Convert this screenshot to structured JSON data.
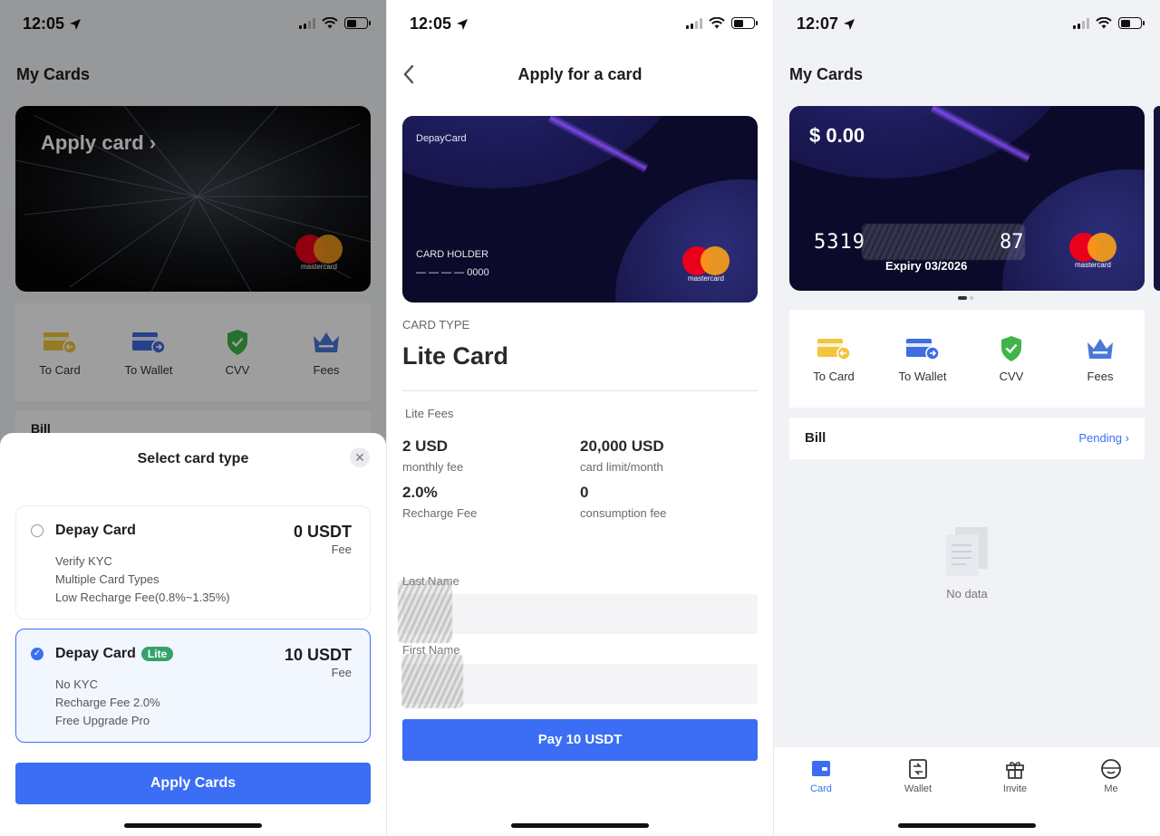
{
  "status": {
    "p1_time": "12:05",
    "p2_time": "12:05",
    "p3_time": "12:07"
  },
  "panel1": {
    "title": "My Cards",
    "card_cta": "Apply card ›",
    "mastercard": "mastercard",
    "actions": [
      {
        "label": "To Card",
        "icon": "card-transfer-icon"
      },
      {
        "label": "To Wallet",
        "icon": "wallet-transfer-icon"
      },
      {
        "label": "CVV",
        "icon": "shield-check-icon"
      },
      {
        "label": "Fees",
        "icon": "crown-icon"
      }
    ],
    "bill_label": "Bill",
    "sheet": {
      "title": "Select card type",
      "close": "✕",
      "options": [
        {
          "name": "Depay Card",
          "badge": "",
          "price": "0 USDT",
          "fee": "Fee",
          "lines": [
            "Verify KYC",
            "Multiple Card Types",
            "Low Recharge Fee(0.8%~1.35%)"
          ],
          "selected": false
        },
        {
          "name": "Depay Card",
          "badge": "Lite",
          "price": "10 USDT",
          "fee": "Fee",
          "lines": [
            "No KYC",
            "Recharge Fee 2.0%",
            "Free Upgrade Pro"
          ],
          "selected": true
        }
      ],
      "apply_button": "Apply Cards"
    }
  },
  "panel2": {
    "title": "Apply for a card",
    "card": {
      "brand": "DepayCard",
      "holder_label": "CARD HOLDER",
      "number": "— — — — 0000",
      "mastercard": "mastercard"
    },
    "card_type_label": "CARD TYPE",
    "card_type_value": "Lite Card",
    "fees_label": "Lite Fees",
    "fees": [
      {
        "value": "2 USD",
        "label": "monthly fee"
      },
      {
        "value": "20,000 USD",
        "label": "card limit/month"
      },
      {
        "value": "2.0%",
        "label": "Recharge Fee"
      },
      {
        "value": "0",
        "label": "consumption fee"
      }
    ],
    "last_name_label": "Last Name",
    "first_name_label": "First Name",
    "last_name_value": "",
    "first_name_value": "",
    "pay_button": "Pay 10 USDT"
  },
  "panel3": {
    "title": "My Cards",
    "card": {
      "balance": "$ 0.00",
      "number_start": "5319",
      "number_end": "87",
      "expiry": "Expiry 03/2026",
      "mastercard": "mastercard"
    },
    "actions": [
      {
        "label": "To Card",
        "icon": "card-transfer-icon"
      },
      {
        "label": "To Wallet",
        "icon": "wallet-transfer-icon"
      },
      {
        "label": "CVV",
        "icon": "shield-check-icon"
      },
      {
        "label": "Fees",
        "icon": "crown-icon"
      }
    ],
    "bill_label": "Bill",
    "bill_status": "Pending",
    "empty_text": "No data",
    "tabs": [
      {
        "label": "Card",
        "icon": "card-tab-icon",
        "active": true
      },
      {
        "label": "Wallet",
        "icon": "wallet-tab-icon",
        "active": false
      },
      {
        "label": "Invite",
        "icon": "gift-icon",
        "active": false
      },
      {
        "label": "Me",
        "icon": "profile-face-icon",
        "active": false
      }
    ]
  },
  "colors": {
    "accent": "#3b6ef5",
    "lite_badge": "#34a36a",
    "cvv_green": "#3fb54a",
    "fees_blue": "#4a78d8",
    "to_card_yellow": "#f2c53d"
  }
}
